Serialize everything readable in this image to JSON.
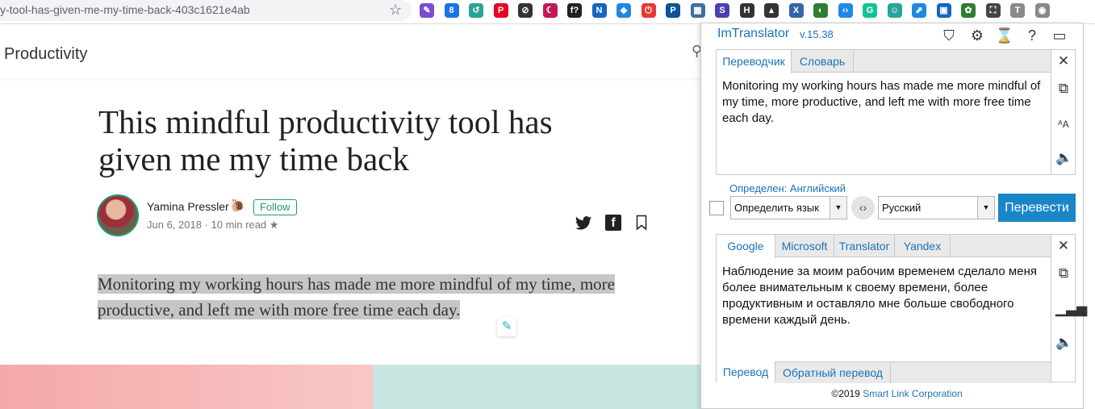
{
  "browser": {
    "url": "y-tool-has-given-me-my-time-back-403c1621e4ab",
    "star_icon": "star-icon",
    "extensions": [
      {
        "name": "feather-extension-icon",
        "color": "#7b4ccf",
        "glyph": "✎"
      },
      {
        "name": "extension-2-icon",
        "color": "#1a73e8",
        "glyph": "8"
      },
      {
        "name": "extension-3-icon",
        "color": "#2aa198",
        "glyph": "↺"
      },
      {
        "name": "pinterest-extension-icon",
        "color": "#e60023",
        "glyph": "P"
      },
      {
        "name": "extension-5-icon",
        "color": "#333333",
        "glyph": "⊘"
      },
      {
        "name": "extension-6-icon",
        "color": "#c2185b",
        "glyph": "☾"
      },
      {
        "name": "fonts-extension-icon",
        "color": "#222222",
        "glyph": "f?"
      },
      {
        "name": "extension-8-icon",
        "color": "#1565c0",
        "glyph": "N"
      },
      {
        "name": "extension-9-icon",
        "color": "#1e88e5",
        "glyph": "◆"
      },
      {
        "name": "extension-10-icon",
        "color": "#e53935",
        "glyph": "⏻"
      },
      {
        "name": "extension-11-icon",
        "color": "#0b5394",
        "glyph": "P"
      },
      {
        "name": "extension-12-icon",
        "color": "#3f6fa1",
        "glyph": "▦"
      },
      {
        "name": "extension-13-icon",
        "color": "#4a3fb5",
        "glyph": "S"
      },
      {
        "name": "extension-14-icon",
        "color": "#333333",
        "glyph": "H"
      },
      {
        "name": "extension-15-icon",
        "color": "#333333",
        "glyph": "▴"
      },
      {
        "name": "extension-16-icon",
        "color": "#3564a6",
        "glyph": "X"
      },
      {
        "name": "extension-17-icon",
        "color": "#2e7d32",
        "glyph": "◐"
      },
      {
        "name": "extension-18-icon",
        "color": "#1e88e5",
        "glyph": "‹›"
      },
      {
        "name": "grammarly-extension-icon",
        "color": "#15c39a",
        "glyph": "G"
      },
      {
        "name": "extension-20-icon",
        "color": "#26a69a",
        "glyph": "☺"
      },
      {
        "name": "extension-21-icon",
        "color": "#1e88e5",
        "glyph": "⬈"
      },
      {
        "name": "extension-22-icon",
        "color": "#1565c0",
        "glyph": "▣"
      },
      {
        "name": "extension-23-icon",
        "color": "#2e7d32",
        "glyph": "✿"
      },
      {
        "name": "extension-24-icon",
        "color": "#444444",
        "glyph": "⛶"
      },
      {
        "name": "extension-25-icon",
        "color": "#8a8a8a",
        "glyph": "T"
      },
      {
        "name": "imtranslator-extension-icon",
        "color": "#888888",
        "glyph": "◉"
      }
    ]
  },
  "site": {
    "section": "Productivity",
    "search_icon": "search-icon"
  },
  "article": {
    "title": "This mindful productivity tool has given me my time back",
    "author": "Yamina Pressler",
    "author_emoji": "🐌",
    "follow": "Follow",
    "meta": "Jun 6, 2018 · 10 min read ★",
    "paragraph": "Monitoring my working hours has made me more mindful of my time, more productive, and left me with more free time each day."
  },
  "translator": {
    "brand": "ImTranslator",
    "version": "v.15.38",
    "source_tabs": [
      "Переводчик",
      "Словарь"
    ],
    "source_text": "Monitoring my working hours has made me more mindful of my time, more productive, and left me with more free time each day.",
    "detected": "Определен: Английский",
    "from_lang": "Определить язык",
    "to_lang": "Русский",
    "translate_button": "Перевести",
    "result_tabs": [
      "Google",
      "Microsoft",
      "Translator",
      "Yandex"
    ],
    "result_text": "Наблюдение за моим рабочим временем сделало меня более внимательным к своему времени, более продуктивным и оставляло мне больше свободного времени каждый день.",
    "bottom_tabs": [
      "Перевод",
      "Обратный перевод"
    ],
    "copyright_prefix": "©2019",
    "copyright_link": "Smart Link Corporation",
    "accent": "#1b86c6"
  }
}
